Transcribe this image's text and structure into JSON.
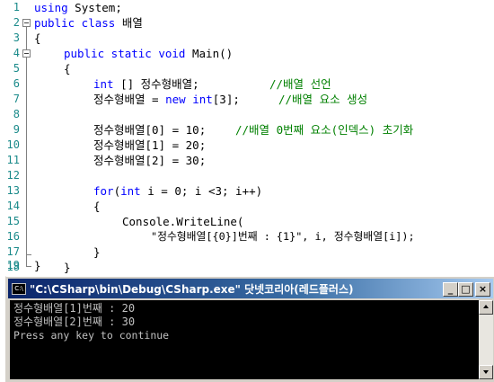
{
  "editor": {
    "line_numbers": [
      "1",
      "2",
      "3",
      "4",
      "5",
      "6",
      "7",
      "8",
      "9",
      "10",
      "11",
      "12",
      "13",
      "14",
      "15",
      "16",
      "17",
      "18",
      "19"
    ],
    "code": {
      "l1_kw": "using",
      "l1_rest": " System;",
      "l2_kw": "public class",
      "l2_rest": " 배열",
      "l3": "{",
      "l4_kw": "public static void",
      "l4_rest": " Main()",
      "l5": "{",
      "l6_kw": "int",
      "l6_rest": " [] 정수형배열;",
      "l6_comment": "//배열 선언",
      "l7_a": "정수형배열 = ",
      "l7_kw1": "new",
      "l7_sp": " ",
      "l7_kw2": "int",
      "l7_b": "[3];",
      "l7_comment": "//배열 요소 생성",
      "l9": "정수형배열[0] = 10;",
      "l9_comment": "//배열 0번째 요소(인덱스) 초기화",
      "l10": "정수형배열[1] = 20;",
      "l11": "정수형배열[2] = 30;",
      "l13_kw1": "for",
      "l13_a": "(",
      "l13_kw2": "int",
      "l13_b": " i = 0; i <3; i++)",
      "l14": "{",
      "l15": "Console.WriteLine(",
      "l16": "\"정수형배열[{0}]번째 : {1}\", i, 정수형배열[i]);",
      "l17": "}",
      "l18": "}",
      "l19": "}"
    }
  },
  "console": {
    "icon_label": "C:\\",
    "title": "\"C:\\CSharp\\bin\\Debug\\CSharp.exe\" 닷넷코리아(레드플러스)",
    "minimize_label": "_",
    "maximize_label": "□",
    "close_label": "×",
    "output": [
      "정수형배열[1]번째 : 20",
      "정수형배열[2]번째 : 30",
      "Press any key to continue"
    ]
  }
}
